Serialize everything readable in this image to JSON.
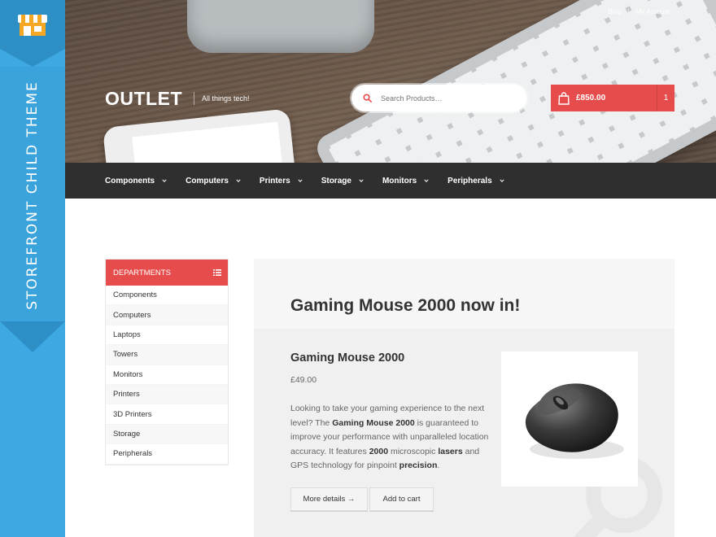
{
  "theme": {
    "name": "STOREFRONT CHILD THEME",
    "accent": "#e74c4c",
    "ribbon_color": "#3ea8e2",
    "nav_bg": "#2f2f2f"
  },
  "header": {
    "logo": "OUTLET",
    "tagline": "All things tech!",
    "top_links": [
      "Blog",
      "My Account"
    ],
    "search": {
      "placeholder": "Search Products…",
      "icon": "search-icon"
    },
    "cart": {
      "total": "£850.00",
      "count": "1",
      "icon": "shopping-bag-icon"
    }
  },
  "nav": {
    "items": [
      {
        "label": "Components"
      },
      {
        "label": "Computers"
      },
      {
        "label": "Printers"
      },
      {
        "label": "Storage"
      },
      {
        "label": "Monitors"
      },
      {
        "label": "Peripherals"
      }
    ]
  },
  "sidebar": {
    "title": "DEPARTMENTS",
    "icon": "list-icon",
    "items": [
      "Components",
      "Computers",
      "Laptops",
      "Towers",
      "Monitors",
      "Printers",
      "3D Printers",
      "Storage",
      "Peripherals"
    ]
  },
  "main": {
    "heading": "Gaming Mouse 2000 now in!",
    "product": {
      "name": "Gaming Mouse 2000",
      "price": "£49.00",
      "desc_parts": [
        "Looking to take your gaming experience to the next level? The ",
        "Gaming Mouse 2000",
        " is guaranteed to improve your performance with unparalleled location accuracy. It features ",
        "2000",
        " microscopic ",
        "lasers",
        " and GPS technology for pinpoint ",
        "precision",
        "."
      ],
      "more_label": "More details →",
      "add_label": "Add to cart"
    }
  }
}
